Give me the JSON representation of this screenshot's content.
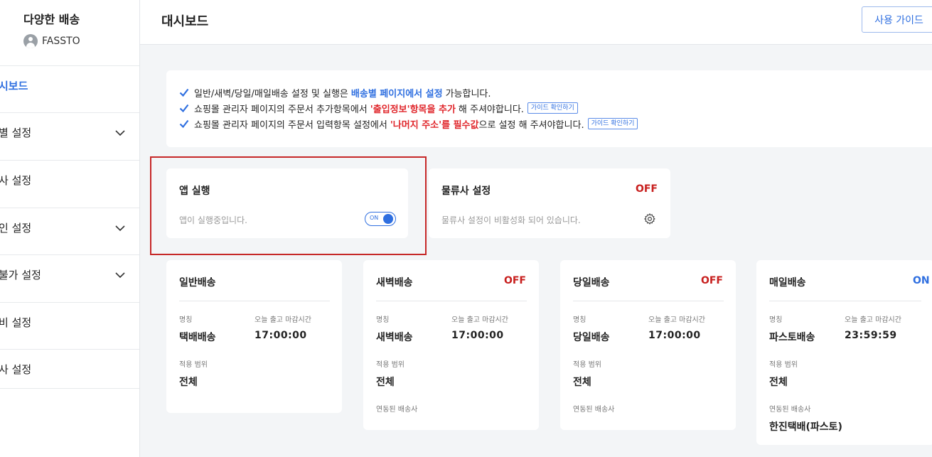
{
  "sidebar": {
    "brand_title": "다양한 배송",
    "user_name": "FASSTO",
    "items": [
      {
        "label": "시보드",
        "has_chevron": false,
        "active": true
      },
      {
        "label": "별 설정",
        "has_chevron": true,
        "active": false
      },
      {
        "label": "사 설정",
        "has_chevron": false,
        "active": false
      },
      {
        "label": "인 설정",
        "has_chevron": true,
        "active": false
      },
      {
        "label": "불가 설정",
        "has_chevron": true,
        "active": false
      },
      {
        "label": "비 설정",
        "has_chevron": false,
        "active": false
      },
      {
        "label": "사 설정",
        "has_chevron": false,
        "active": false
      }
    ]
  },
  "header": {
    "title": "대시보드",
    "guide_button": "사용 가이드"
  },
  "notice": {
    "line1": {
      "before": "일반/새벽/당일/매일배송 설정 및 실행은",
      "highlight": "배송별 페이지에서 설정",
      "after": "가능합니다."
    },
    "line2": {
      "before": "쇼핑몰 관리자 페이지의 주문서 추가항목에서",
      "highlight": "'출입정보'항목을 추가",
      "after": "해 주셔야합니다.",
      "link": "가이드 확인하기"
    },
    "line3": {
      "before": "쇼핑몰 관리자 페이지의 주문서 입력항목 설정에서",
      "highlight": "'나머지 주소'를 필수값",
      "after": "으로 설정 해 주셔야합니다.",
      "link": "가이드 확인하기"
    }
  },
  "app_card": {
    "title": "앱 실행",
    "desc": "앱이 실행중입니다.",
    "toggle_label": "ON",
    "toggle_on": true
  },
  "logistics_card": {
    "title": "물류사 설정",
    "status": "OFF",
    "desc": "물류사 설정이 비활성화 되어 있습니다.",
    "icon": "gear-icon"
  },
  "delivery_cards": [
    {
      "title": "일반배송",
      "status": "",
      "name_label": "명칭",
      "name": "택배배송",
      "cutoff_label": "오늘 출고 마감시간",
      "cutoff": "17:00:00",
      "scope_label": "적용 범위",
      "scope": "전체",
      "carrier_label": "",
      "carrier": ""
    },
    {
      "title": "새벽배송",
      "status": "OFF",
      "name_label": "명칭",
      "name": "새벽배송",
      "cutoff_label": "오늘 출고 마감시간",
      "cutoff": "17:00:00",
      "scope_label": "적용 범위",
      "scope": "전체",
      "carrier_label": "연동된 배송사",
      "carrier": ""
    },
    {
      "title": "당일배송",
      "status": "OFF",
      "name_label": "명칭",
      "name": "당일배송",
      "cutoff_label": "오늘 출고 마감시간",
      "cutoff": "17:00:00",
      "scope_label": "적용 범위",
      "scope": "전체",
      "carrier_label": "연동된 배송사",
      "carrier": ""
    },
    {
      "title": "매일배송",
      "status": "ON",
      "name_label": "명칭",
      "name": "파스토배송",
      "cutoff_label": "오늘 출고 마감시간",
      "cutoff": "23:59:59",
      "scope_label": "적용 범위",
      "scope": "전체",
      "carrier_label": "연동된 배송사",
      "carrier": "한진택배(파스토)"
    }
  ],
  "colors": {
    "accent": "#2f6fe0",
    "off": "#c8201f",
    "highlight_red": "#e0262b",
    "frame": "#c62828"
  }
}
